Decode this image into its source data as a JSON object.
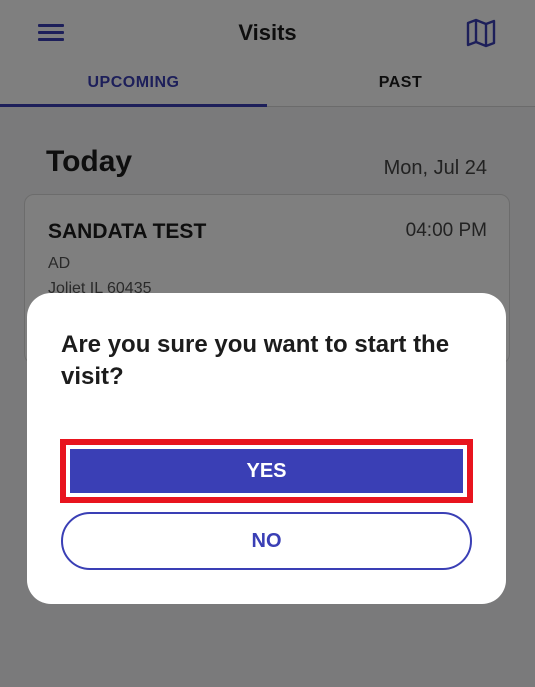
{
  "header": {
    "title": "Visits",
    "menu_icon": "hamburger-menu-icon",
    "map_icon": "map-icon"
  },
  "tabs": [
    {
      "label": "UPCOMING",
      "active": true
    },
    {
      "label": "PAST",
      "active": false
    }
  ],
  "section": {
    "title": "Today",
    "date": "Mon, Jul 24"
  },
  "visit": {
    "client": "SANDATA TEST",
    "time": "04:00 PM",
    "service": "AD",
    "address": "Joliet IL 60435"
  },
  "dialog": {
    "message": "Are you sure you want to start the visit?",
    "yes_label": "YES",
    "no_label": "NO"
  },
  "colors": {
    "accent": "#3a3fb5",
    "highlight": "#e8141e"
  }
}
